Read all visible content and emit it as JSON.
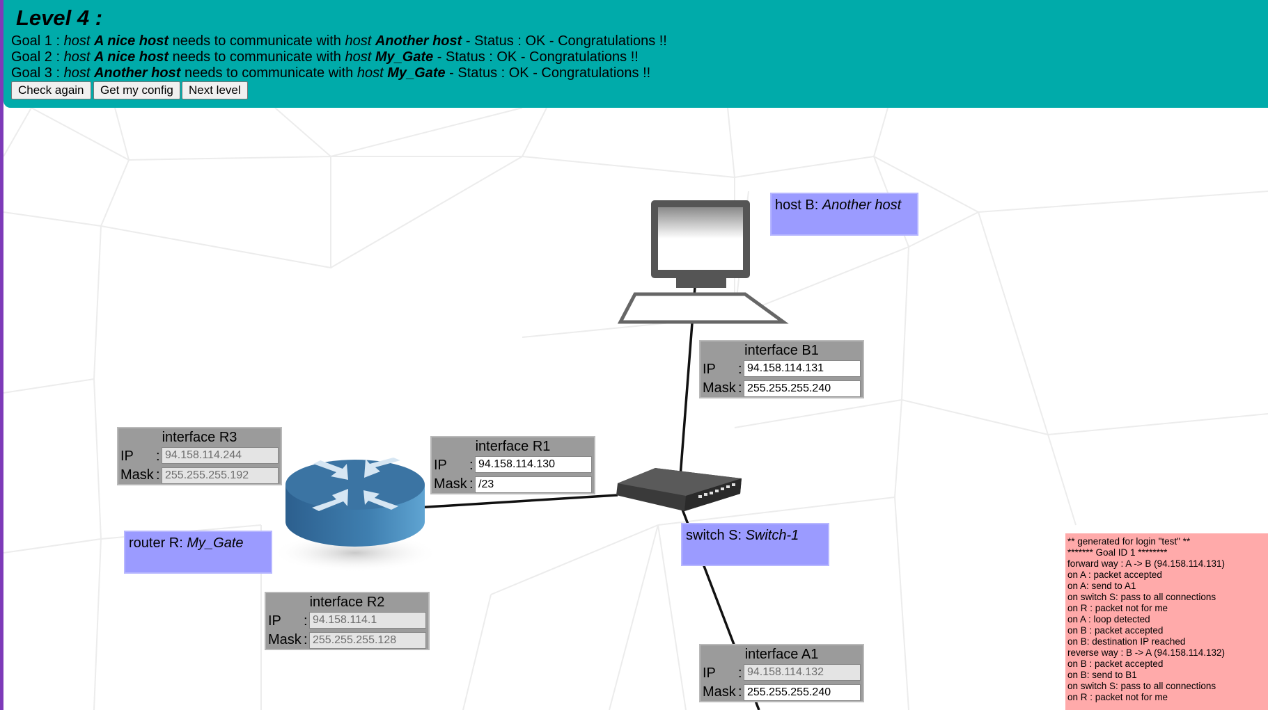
{
  "header": {
    "title": "Level 4 :",
    "goals": [
      {
        "prefix": "Goal 1 : ",
        "h1": "host ",
        "n1": "A nice host",
        "mid": " needs to communicate with ",
        "h2": "host ",
        "n2": "Another host",
        "status": " - Status : OK - Congratulations !!"
      },
      {
        "prefix": "Goal 2 : ",
        "h1": "host ",
        "n1": "A nice host",
        "mid": " needs to communicate with ",
        "h2": "host ",
        "n2": "My_Gate",
        "status": " - Status : OK - Congratulations !!"
      },
      {
        "prefix": "Goal 3 : ",
        "h1": "host ",
        "n1": "Another host",
        "mid": " needs to communicate with ",
        "h2": "host ",
        "n2": "My_Gate",
        "status": " - Status : OK - Congratulations !!"
      }
    ],
    "buttons": {
      "check": "Check again",
      "config": "Get my config",
      "next": "Next level"
    }
  },
  "interfaces": {
    "b1": {
      "title": "interface B1",
      "ip_label": "IP",
      "mask_label": "Mask",
      "colon": ":",
      "ip": "94.158.114.131",
      "mask": "255.255.255.240"
    },
    "r1": {
      "title": "interface R1",
      "ip_label": "IP",
      "mask_label": "Mask",
      "colon": ":",
      "ip": "94.158.114.130",
      "mask": "/23"
    },
    "r3": {
      "title": "interface R3",
      "ip_label": "IP",
      "mask_label": "Mask",
      "colon": ":",
      "ip": "94.158.114.244",
      "mask": "255.255.255.192"
    },
    "r2": {
      "title": "interface R2",
      "ip_label": "IP",
      "mask_label": "Mask",
      "colon": ":",
      "ip": "94.158.114.1",
      "mask": "255.255.255.128"
    },
    "a1": {
      "title": "interface A1",
      "ip_label": "IP",
      "mask_label": "Mask",
      "colon": ":",
      "ip": "94.158.114.132",
      "mask": "255.255.255.240"
    }
  },
  "devices": {
    "host_b": {
      "prefix": "host B: ",
      "name": "Another host"
    },
    "router_r": {
      "prefix": "router R: ",
      "name": "My_Gate"
    },
    "switch_s": {
      "prefix": "switch S: ",
      "name": "Switch-1"
    }
  },
  "log": [
    "** generated for login \"test\" **",
    "******* Goal ID 1 ********",
    "forward way : A -> B (94.158.114.131)",
    "on A : packet accepted",
    "on A: send to A1",
    "on switch S: pass to all connections",
    "on R : packet not for me",
    "on A : loop detected",
    "on B : packet accepted",
    "on B: destination IP reached",
    "reverse way : B -> A (94.158.114.132)",
    "on B : packet accepted",
    "on B: send to B1",
    "on switch S: pass to all connections",
    "on R : packet not for me"
  ],
  "colors": {
    "header": "#00abaa",
    "name_box": "#9b9bff",
    "interface_box": "#9b9b9b",
    "log_bg": "#ffaaaa"
  }
}
